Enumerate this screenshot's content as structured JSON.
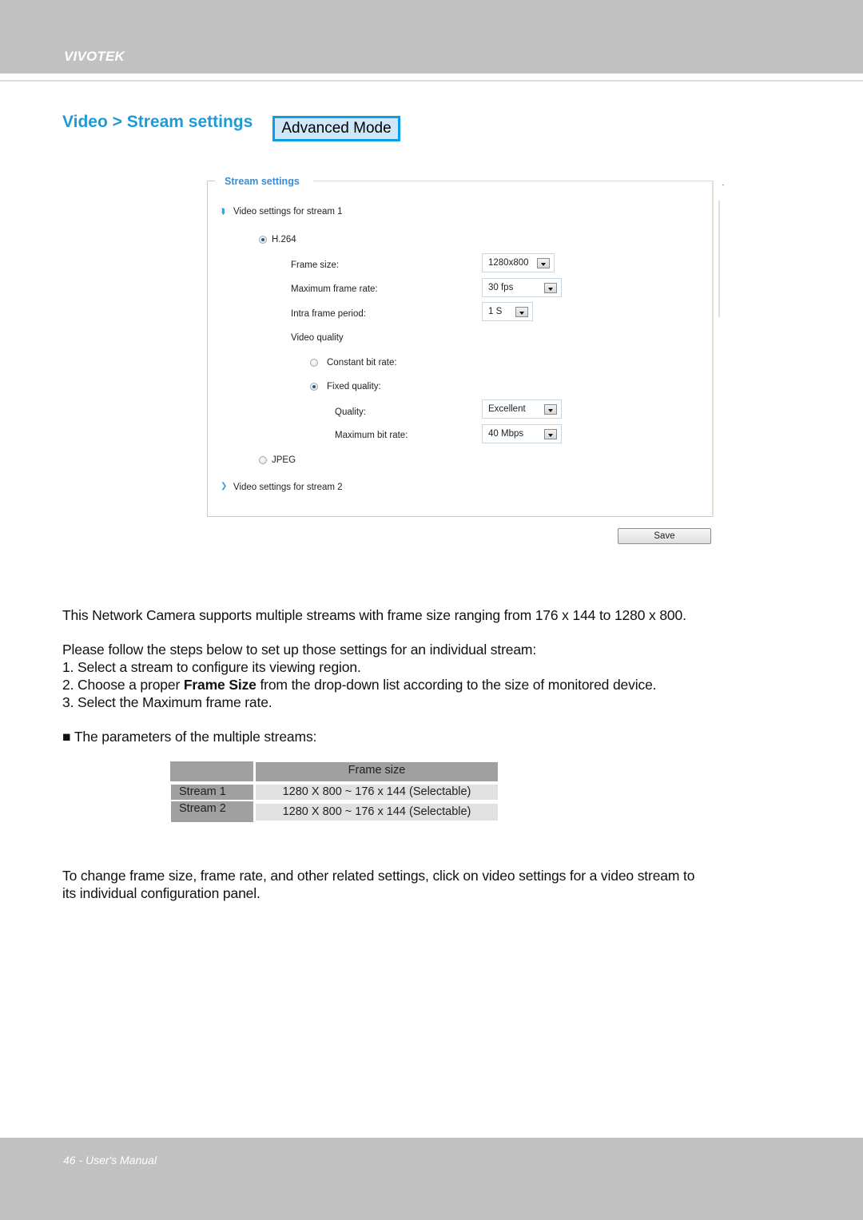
{
  "header": {
    "brand": "VIVOTEK"
  },
  "page": {
    "title": "Video > Stream settings",
    "advanced_mode_label": "Advanced Mode"
  },
  "panel": {
    "legend": "Stream settings",
    "stream1_toggle": "Video settings for stream 1",
    "stream1_expanded": true,
    "codec_h264_label": "H.264",
    "codec_h264_selected": true,
    "frame_size_label": "Frame size:",
    "frame_size_value": "1280x800",
    "max_frame_rate_label": "Maximum frame rate:",
    "max_frame_rate_value": "30 fps",
    "intra_frame_label": "Intra frame period:",
    "intra_frame_value": "1 S",
    "video_quality_label": "Video quality",
    "constant_bit_rate_label": "Constant bit rate:",
    "constant_bit_rate_selected": false,
    "fixed_quality_label": "Fixed quality:",
    "fixed_quality_selected": true,
    "quality_label": "Quality:",
    "quality_value": "Excellent",
    "max_bit_rate_label": "Maximum bit rate:",
    "max_bit_rate_value": "40 Mbps",
    "codec_jpeg_label": "JPEG",
    "codec_jpeg_selected": false,
    "stream2_toggle": "Video settings for stream 2",
    "stream2_expanded": false,
    "save_label": "Save"
  },
  "body": {
    "intro": "This Network Camera supports multiple streams with frame size ranging from 176 x 144 to 1280 x 800.",
    "steps_intro": "Please follow the steps below to set up those settings for an individual stream:",
    "step1": "1. Select a stream to configure its viewing region.",
    "step2_prefix": "2. Choose a proper ",
    "step2_bold": "Frame Size",
    "step2_suffix": " from the drop-down list according to the size of monitored device.",
    "step3": "3. Select the Maximum frame rate.",
    "params_heading": "■ The parameters of the multiple streams:",
    "closing_line1": "To change frame size, frame rate, and other related settings, click on video settings for a video stream to",
    "closing_line2": "its individual configuration panel."
  },
  "table": {
    "headers": [
      "",
      "Frame size"
    ],
    "rows": [
      {
        "name": "Stream 1",
        "frame_size": "1280 X 800 ~ 176 x 144 (Selectable)"
      },
      {
        "name": "Stream 2",
        "frame_size": "1280 X 800 ~ 176 x 144 (Selectable)"
      }
    ]
  },
  "footer": {
    "page_label": "46 - User's Manual"
  },
  "colors": {
    "band_gray": "#c0c1c0",
    "title_blue": "#1e9ad9",
    "button_border_blue": "#0a9de6",
    "button_fill": "#cfe8f9",
    "table_header_gray": "#a0a0a0",
    "table_cell_gray": "#e1e1e1"
  }
}
